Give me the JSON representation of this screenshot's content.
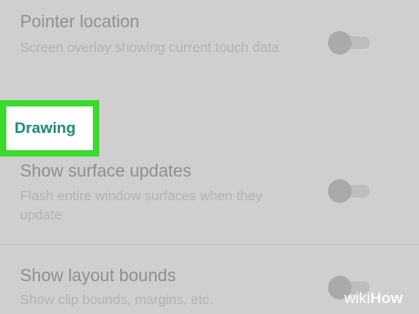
{
  "settings": {
    "pointer_location": {
      "title": "Pointer location",
      "summary": "Screen overlay showing current touch data",
      "enabled": false
    },
    "drawing_category": "Drawing",
    "show_surface_updates": {
      "title": "Show surface updates",
      "summary": "Flash entire window surfaces when they update",
      "enabled": false
    },
    "show_layout_bounds": {
      "title": "Show layout bounds",
      "summary": "Show clip bounds, margins, etc.",
      "enabled": false
    }
  },
  "watermark": {
    "part1": "wiki",
    "part2": "How"
  },
  "colors": {
    "highlight": "#3adb2c",
    "category_text": "#1f8a72"
  }
}
